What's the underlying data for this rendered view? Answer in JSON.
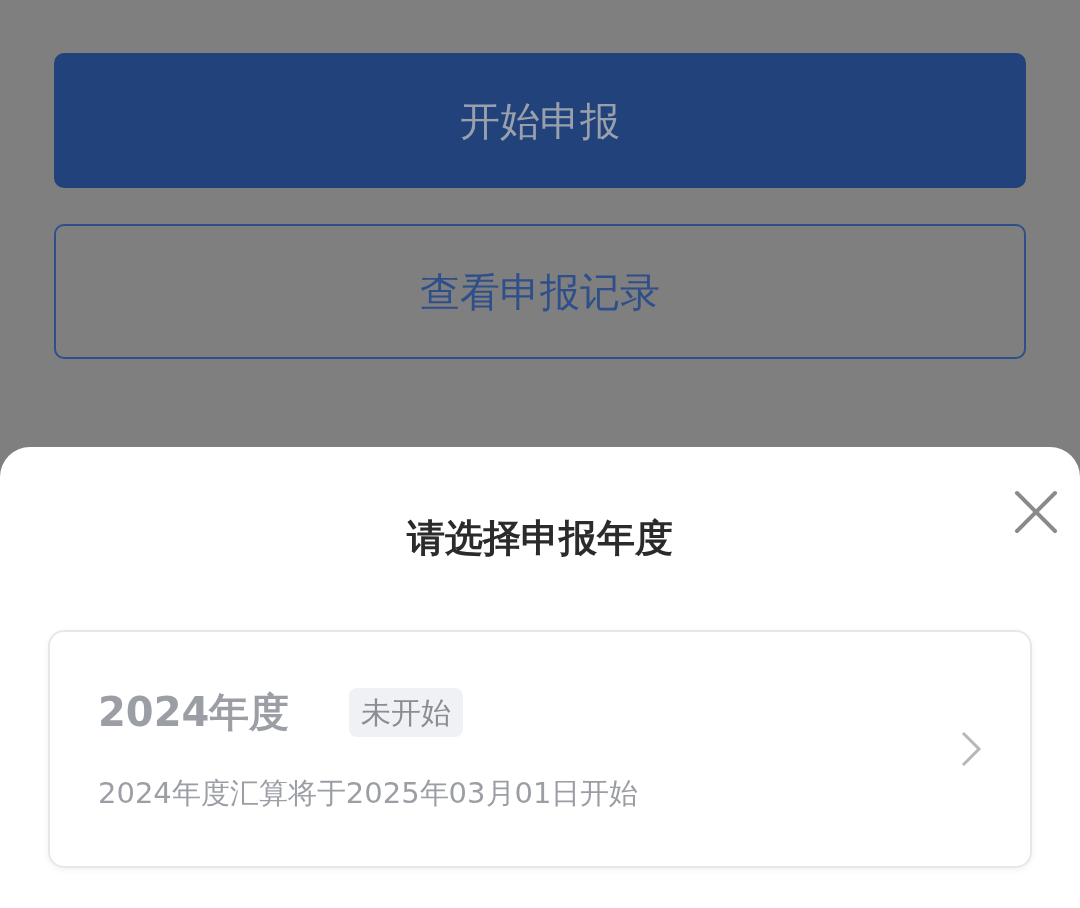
{
  "buttons": [
    {
      "label": "开始申报",
      "kind": "primary"
    },
    {
      "label": "查看申报记录",
      "kind": "outline"
    }
  ],
  "sheet": {
    "title": "请选择申报年度",
    "years": [
      {
        "year": "2024年度",
        "status": "未开始",
        "note": "2024年度汇算将于2025年03月01日开始",
        "disabled": true
      }
    ]
  }
}
